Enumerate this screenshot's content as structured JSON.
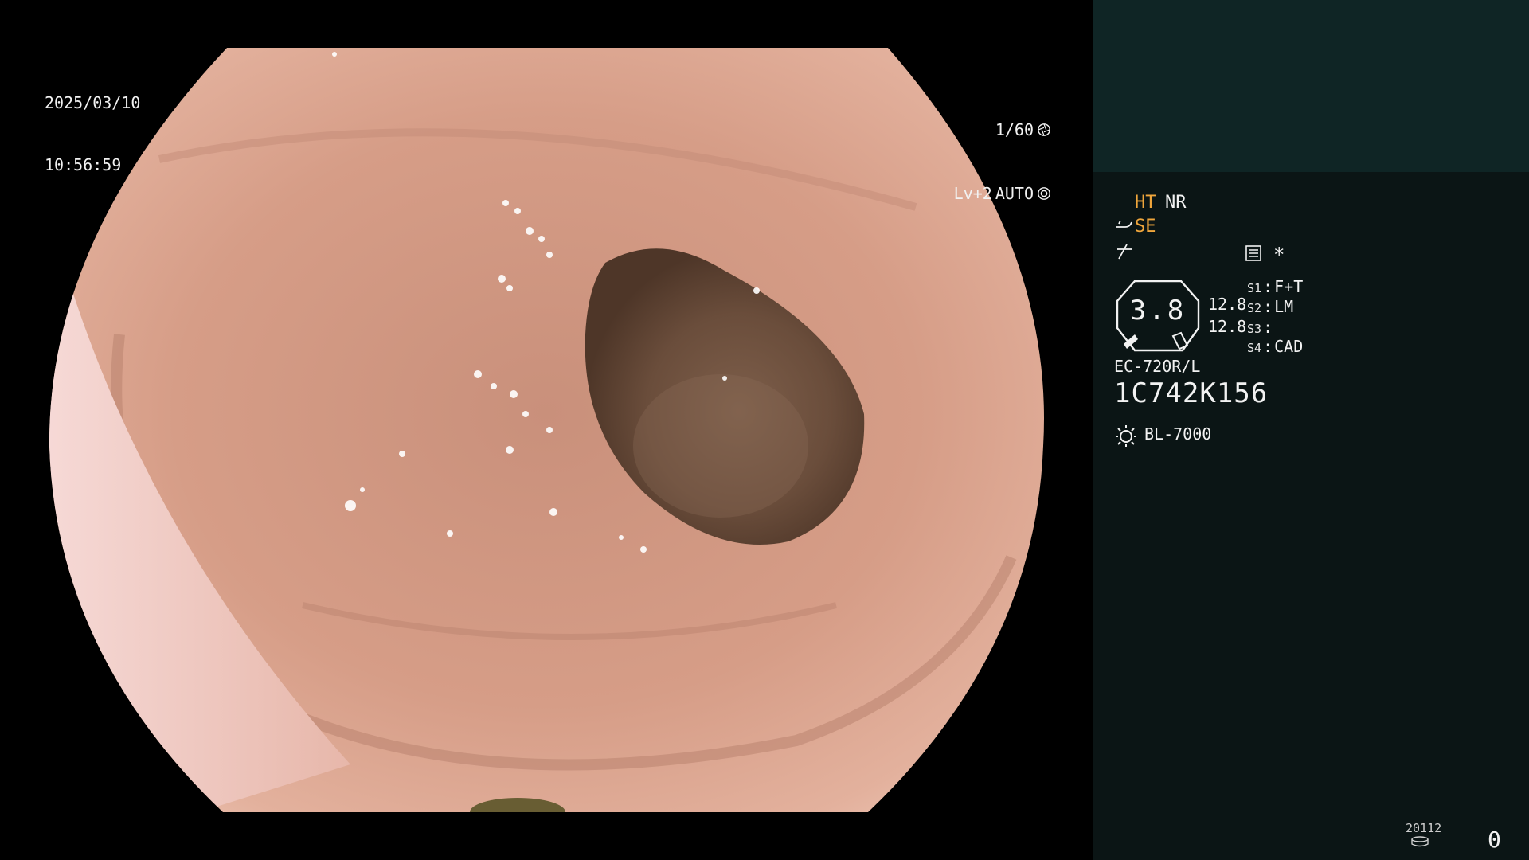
{
  "overlay": {
    "date": "2025/03/10",
    "time": "10:56:59",
    "shutter": "1/60",
    "shutter_icon": "aperture-icon",
    "iris_level": "Lv+2",
    "iris_mode": "AUTO",
    "iris_icon": "iris-icon"
  },
  "panel": {
    "ht": "HT",
    "nr": "NR",
    "se": "SE",
    "star": "*",
    "gauge_value": "3.8",
    "value1": "12.8",
    "value2": "12.8",
    "switches": [
      {
        "label": "S1",
        "value": "F+T"
      },
      {
        "label": "S2",
        "value": "LM"
      },
      {
        "label": "S3",
        "value": ""
      },
      {
        "label": "S4",
        "value": "CAD"
      }
    ],
    "scope_model": "EC-720R/L",
    "serial": "1C742K156",
    "light_source": "BL-7000",
    "disk_number": "20112",
    "counter": "0",
    "colors": {
      "accent": "#f0a63c",
      "panel_bg": "#0b1515",
      "panel_top": "#0f2525",
      "text": "#f2f2f2"
    }
  }
}
